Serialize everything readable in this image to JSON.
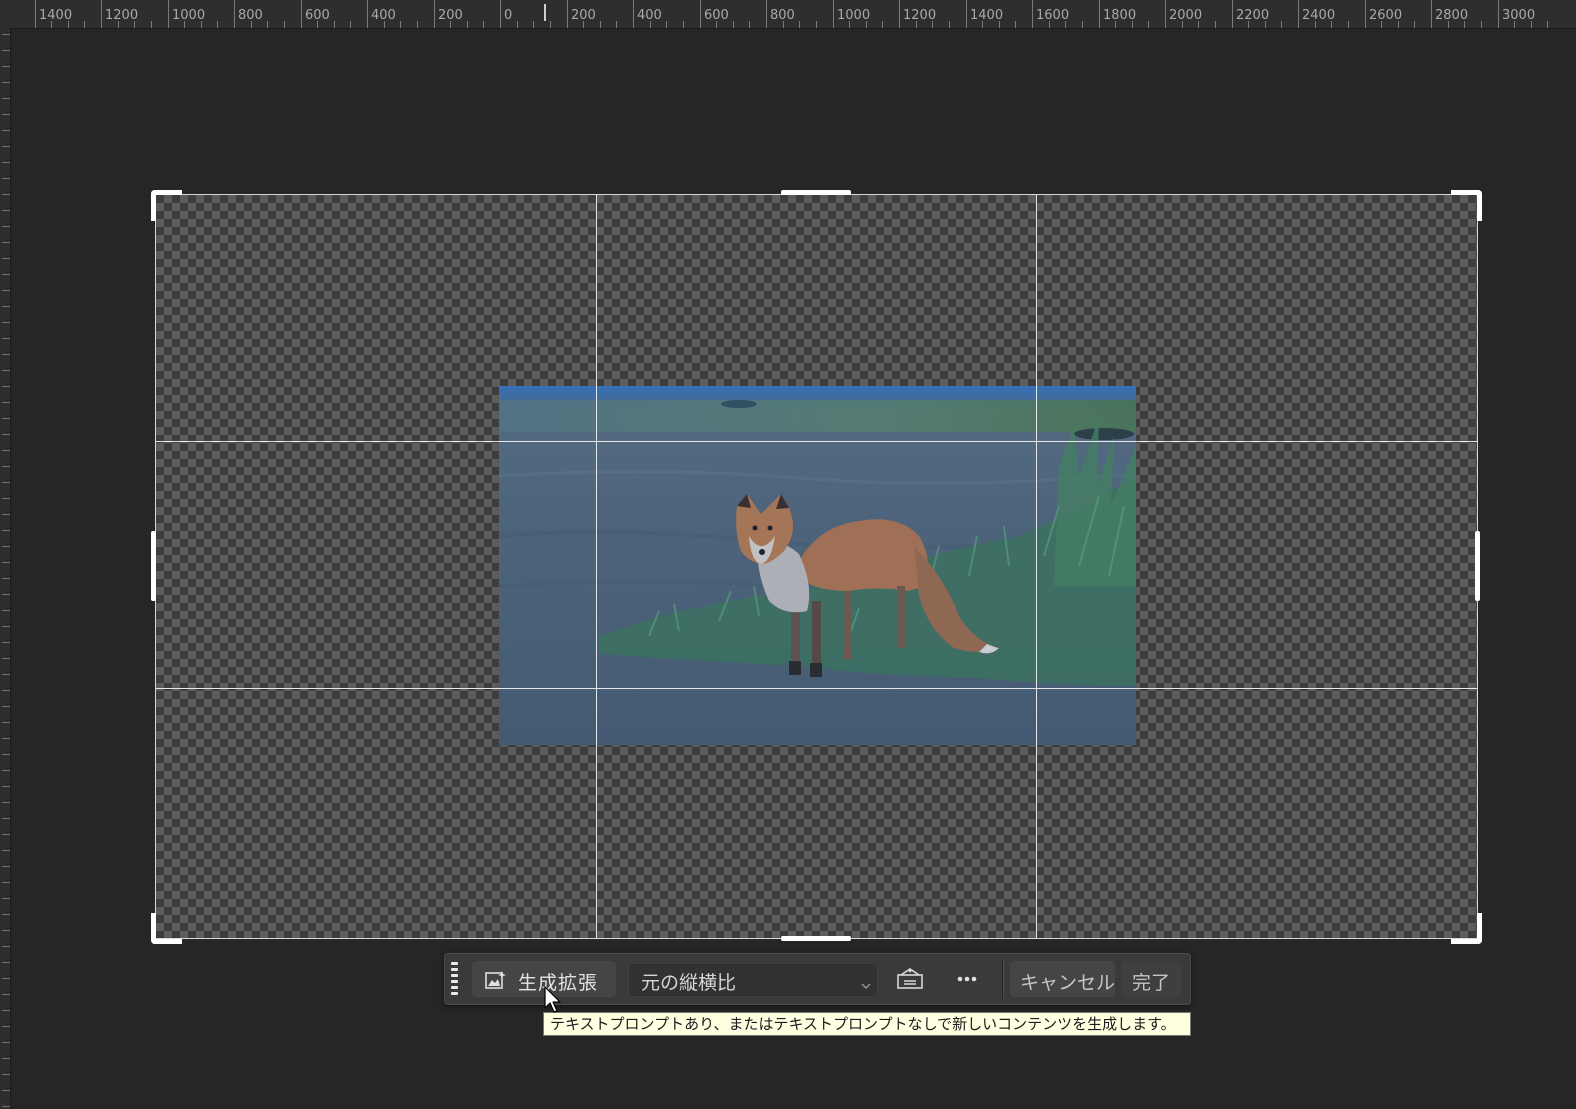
{
  "ruler": {
    "top_labels": [
      "1400",
      "1200",
      "1000",
      "800",
      "600",
      "400",
      "200",
      "0",
      "200",
      "400",
      "600",
      "800",
      "1000",
      "1200",
      "1400",
      "1600",
      "1800",
      "2000",
      "2200",
      "2400",
      "2600",
      "2800",
      "3000"
    ]
  },
  "canvas": {
    "background_color": "#262626",
    "crop_frame_color": "#ffffff",
    "transparency_pattern": "checkerboard",
    "image": {
      "subject": "fox",
      "icon": "photo"
    }
  },
  "taskbar": {
    "grip_icon": "grip-dots-icon",
    "generative_expand": {
      "icon": "generative-expand-icon",
      "label": "生成拡張"
    },
    "aspect_ratio": {
      "selected": "元の縦横比",
      "icon": "chevron-down-icon"
    },
    "swap_icon": "swap-orientation-icon",
    "more_icon": "more-icon",
    "cancel_label": "キャンセル",
    "done_label": "完了"
  },
  "tooltip": {
    "text": "テキストプロンプトあり、またはテキストプロンプトなしで新しいコンテンツを生成します。"
  }
}
